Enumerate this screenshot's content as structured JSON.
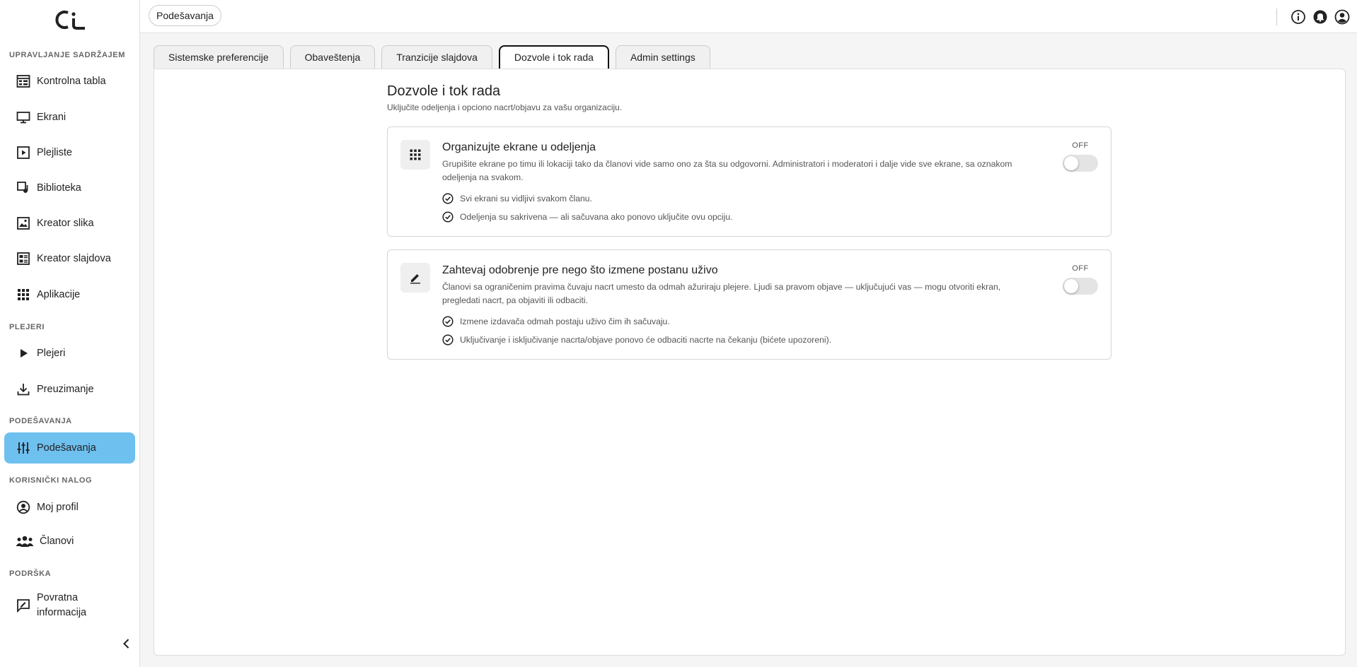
{
  "sidebar": {
    "sections": {
      "content": "UPRAVLJANJE SADRŽAJEM",
      "players": "PLEJERI",
      "settings": "PODEŠAVANJA",
      "account": "KORISNIČKI NALOG",
      "support": "PODRŠKA"
    },
    "items": {
      "dashboard": "Kontrolna tabla",
      "screens": "Ekrani",
      "playlists": "Plejliste",
      "library": "Biblioteka",
      "image_creator": "Kreator slika",
      "slide_creator": "Kreator slajdova",
      "apps": "Aplikacije",
      "players": "Plejeri",
      "download": "Preuzimanje",
      "settings": "Podešavanja",
      "profile": "Moj profil",
      "members": "Članovi",
      "feedback_line1": "Povratna",
      "feedback_line2": "informacija"
    },
    "active_color": "#6ec0ef"
  },
  "header": {
    "breadcrumb": "Podešavanja",
    "icons": [
      "info-icon",
      "notifications-icon",
      "account-icon"
    ]
  },
  "tabs": [
    {
      "label": "Sistemske preferencije",
      "active": false
    },
    {
      "label": "Obaveštenja",
      "active": false
    },
    {
      "label": "Tranzicije slajdova",
      "active": false
    },
    {
      "label": "Dozvole i tok rada",
      "active": true
    },
    {
      "label": "Admin settings",
      "active": false
    }
  ],
  "main": {
    "title": "Dozvole i tok rada",
    "subtitle": "Uključite odeljenja i opciono nacrt/objavu za vašu organizaciju.",
    "cards": [
      {
        "icon": "grid-icon",
        "title": "Organizujte ekrane u odeljenja",
        "description": "Grupišite ekrane po timu ili lokaciji tako da članovi vide samo ono za šta su odgovorni. Administratori i moderatori i dalje vide sve ekrane, sa oznakom odeljenja na svakom.",
        "checks": [
          "Svi ekrani su vidljivi svakom članu.",
          "Odeljenja su sakrivena — ali sačuvana ako ponovo uključite ovu opciju."
        ],
        "toggle_label": "OFF",
        "enabled": false
      },
      {
        "icon": "edit-icon",
        "title": "Zahtevaj odobrenje pre nego što izmene postanu uživo",
        "description": "Članovi sa ograničenim pravima čuvaju nacrt umesto da odmah ažuriraju plejere. Ljudi sa pravom objave — uključujući vas — mogu otvoriti ekran, pregledati nacrt, pa objaviti ili odbaciti.",
        "checks": [
          "Izmene izdavača odmah postaju uživo čim ih sačuvaju.",
          "Uključivanje i isključivanje nacrta/objave ponovo će odbaciti nacrte na čekanju (bićete upozoreni)."
        ],
        "toggle_label": "OFF",
        "enabled": false
      }
    ]
  }
}
